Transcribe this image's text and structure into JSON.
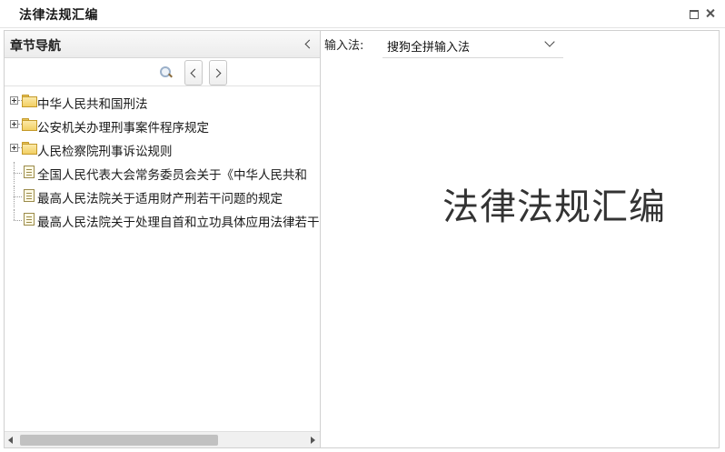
{
  "window": {
    "title": "法律法规汇编",
    "maximize_icon": "maximize-icon",
    "close_icon": "close-icon"
  },
  "sidebar": {
    "title": "章节导航",
    "collapse_icon": "chevron-left-icon",
    "toolbar": {
      "search_icon": "search-icon",
      "prev_icon": "chevron-left-icon",
      "next_icon": "chevron-right-icon"
    },
    "tree": [
      {
        "label": "中华人民共和国刑法",
        "type": "folder",
        "expandable": true
      },
      {
        "label": "公安机关办理刑事案件程序规定",
        "type": "folder",
        "expandable": true
      },
      {
        "label": "人民检察院刑事诉讼规则",
        "type": "folder",
        "expandable": true
      },
      {
        "label": "全国人民代表大会常务委员会关于《中华人民共和",
        "type": "document",
        "expandable": false
      },
      {
        "label": "最高人民法院关于适用财产刑若干问题的规定",
        "type": "document",
        "expandable": false
      },
      {
        "label": "最高人民法院关于处理自首和立功具体应用法律若干",
        "type": "document",
        "expandable": false
      }
    ],
    "scrollbar": {
      "horizontal_position": 0.0
    }
  },
  "main": {
    "ime_label": "输入法:",
    "ime_selected": "搜狗全拼输入法",
    "heading": "法律法规汇编"
  },
  "colors": {
    "folder": "#f2cf63",
    "header_bg": "#ececec",
    "border": "#d0d0d0",
    "heading_text": "#333333"
  }
}
